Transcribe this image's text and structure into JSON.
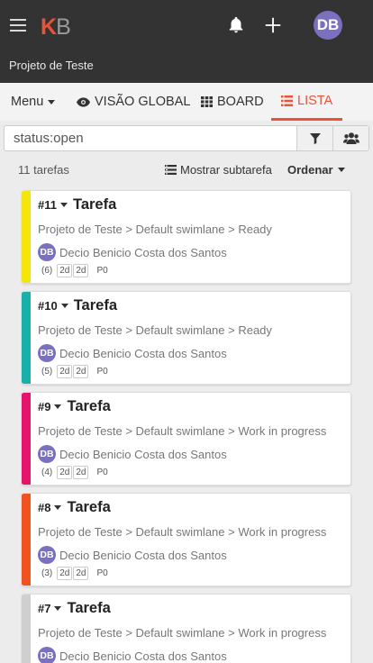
{
  "header": {
    "logo_k": "K",
    "logo_b": "B",
    "avatar_initials": "DB",
    "project_name": "Projeto de Teste"
  },
  "tabs": {
    "menu": "Menu",
    "global": "VISÃO GLOBAL",
    "board": "BOARD",
    "list": "LISTA"
  },
  "filter": {
    "value": "status:open"
  },
  "summary": {
    "count": "11 tarefas",
    "subtasks": "Mostrar subtarefa",
    "sort": "Ordenar"
  },
  "colors": {
    "brand": "#e8533a",
    "avatar": "#7b6fc0",
    "header_bg": "#333333"
  },
  "tasks": [
    {
      "id": "#11",
      "title": "Tarefa",
      "path": "Projeto de Teste > Default swimlane > Ready",
      "assignee": "Decio Benicio Costa dos Santos",
      "initials": "DB",
      "position": "(6)",
      "badge1": "2d",
      "badge2": "2d",
      "priority": "P0",
      "color": "#f5e50b"
    },
    {
      "id": "#10",
      "title": "Tarefa",
      "path": "Projeto de Teste > Default swimlane > Ready",
      "assignee": "Decio Benicio Costa dos Santos",
      "initials": "DB",
      "position": "(5)",
      "badge1": "2d",
      "badge2": "2d",
      "priority": "P0",
      "color": "#19b0aa"
    },
    {
      "id": "#9",
      "title": "Tarefa",
      "path": "Projeto de Teste > Default swimlane > Work in progress",
      "assignee": "Decio Benicio Costa dos Santos",
      "initials": "DB",
      "position": "(4)",
      "badge1": "2d",
      "badge2": "2d",
      "priority": "P0",
      "color": "#e3166b"
    },
    {
      "id": "#8",
      "title": "Tarefa",
      "path": "Projeto de Teste > Default swimlane > Work in progress",
      "assignee": "Decio Benicio Costa dos Santos",
      "initials": "DB",
      "position": "(3)",
      "badge1": "2d",
      "badge2": "2d",
      "priority": "P0",
      "color": "#f0531f"
    },
    {
      "id": "#7",
      "title": "Tarefa",
      "path": "Projeto de Teste > Default swimlane > Work in progress",
      "assignee": "Decio Benicio Costa dos Santos",
      "initials": "DB",
      "position": "",
      "badge1": "",
      "badge2": "",
      "priority": "",
      "color": "#cfcfcf"
    }
  ]
}
